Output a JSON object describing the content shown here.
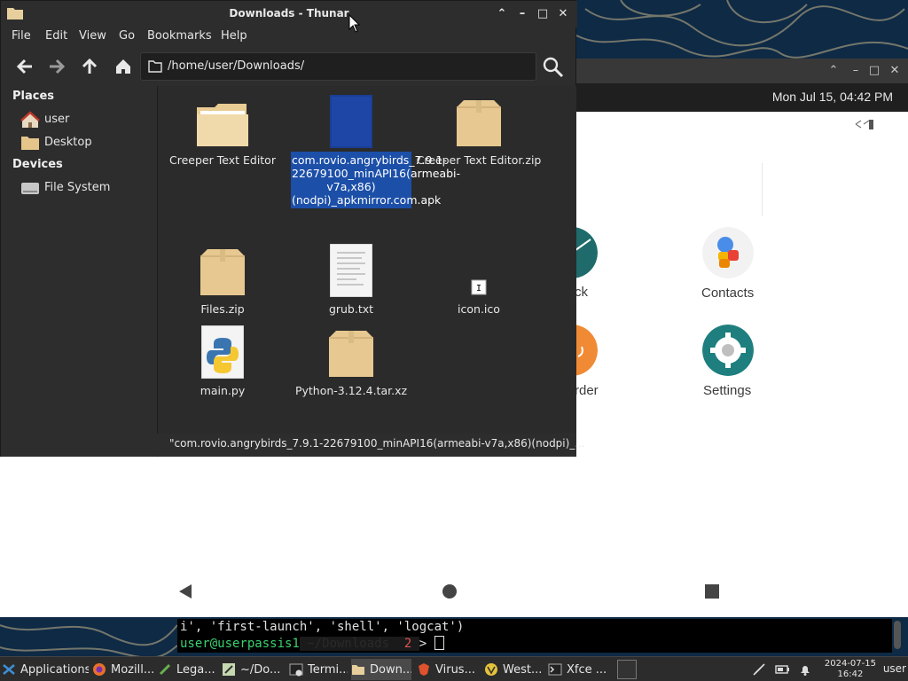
{
  "thunar": {
    "title": "Downloads - Thunar",
    "menus": [
      "File",
      "Edit",
      "View",
      "Go",
      "Bookmarks",
      "Help"
    ],
    "path": "/home/user/Downloads/",
    "sidebar": {
      "places_heading": "Places",
      "places": [
        "user",
        "Desktop"
      ],
      "devices_heading": "Devices",
      "devices": [
        "File System"
      ]
    },
    "files": [
      {
        "name": "Creeper Text Editor",
        "icon": "folder-icon"
      },
      {
        "name": "com.rovio.angrybirds_7.9.1-22679100_minAPI16(armeabi-v7a,x86)(nodpi)_apkmirror.com.apk",
        "icon": "apk-icon",
        "selected": true
      },
      {
        "name": "Creeper Text Editor.zip",
        "icon": "archive-icon"
      },
      {
        "name": "Files.zip",
        "icon": "archive-icon"
      },
      {
        "name": "grub.txt",
        "icon": "text-file-icon"
      },
      {
        "name": "icon.ico",
        "icon": "ico-file-icon"
      },
      {
        "name": "main.py",
        "icon": "python-file-icon"
      },
      {
        "name": "Python-3.12.4.tar.xz",
        "icon": "archive-icon"
      }
    ],
    "status": "\"com.rovio.angrybirds_7.9.1-22679100_minAPI16(armeabi-v7a,x86)(nodpi)_..."
  },
  "emulator": {
    "clock": "Mon Jul 15, 04:42 PM",
    "apps": [
      {
        "name": "ck",
        "icon": "clock-icon"
      },
      {
        "name": "Contacts",
        "icon": "contacts-icon"
      },
      {
        "name": "rder",
        "icon": "recorder-icon"
      },
      {
        "name": "Settings",
        "icon": "settings-icon"
      }
    ]
  },
  "terminal": {
    "line1": "i', 'first-launch', 'shell', 'logcat')",
    "prompt_user": "user@userpassis1",
    "prompt_path": " ~/Downloads ",
    "prompt_num": " 2 ",
    "prompt_arrow": ">"
  },
  "taskbar": {
    "tasks": [
      "Applications",
      "Mozill...",
      "Lega...",
      "~/Do...",
      "Termi...",
      "Down...",
      "Virus...",
      "West...",
      "Xfce ..."
    ],
    "date": "2024-07-15",
    "time": "16:42",
    "user": "user"
  },
  "colors": {
    "selection": "#1c4fa8",
    "window_bg": "#2d2d2d",
    "folder": "#e8c98f",
    "terminal_green": "#3bd16f",
    "terminal_red": "#e05050",
    "android_teal": "#1e7f7f"
  }
}
